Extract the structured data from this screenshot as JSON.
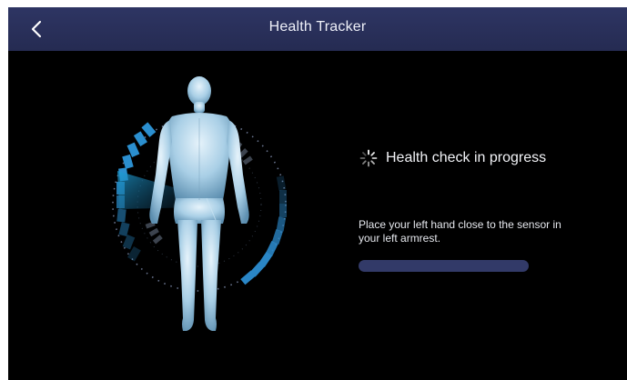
{
  "header": {
    "title": "Health Tracker",
    "back_icon": "chevron-left-icon"
  },
  "status": {
    "icon": "loading-spinner-icon",
    "text": "Health check in progress"
  },
  "instruction": {
    "text": "Place your left hand close to the sensor in your left armrest."
  },
  "progress": {
    "fraction": 0.0
  },
  "illustration": {
    "icon": "human-body-scan-icon"
  },
  "colors": {
    "titlebar": "#2a3059",
    "accent": "#3aa6e0",
    "progress_track": "#323a68"
  }
}
